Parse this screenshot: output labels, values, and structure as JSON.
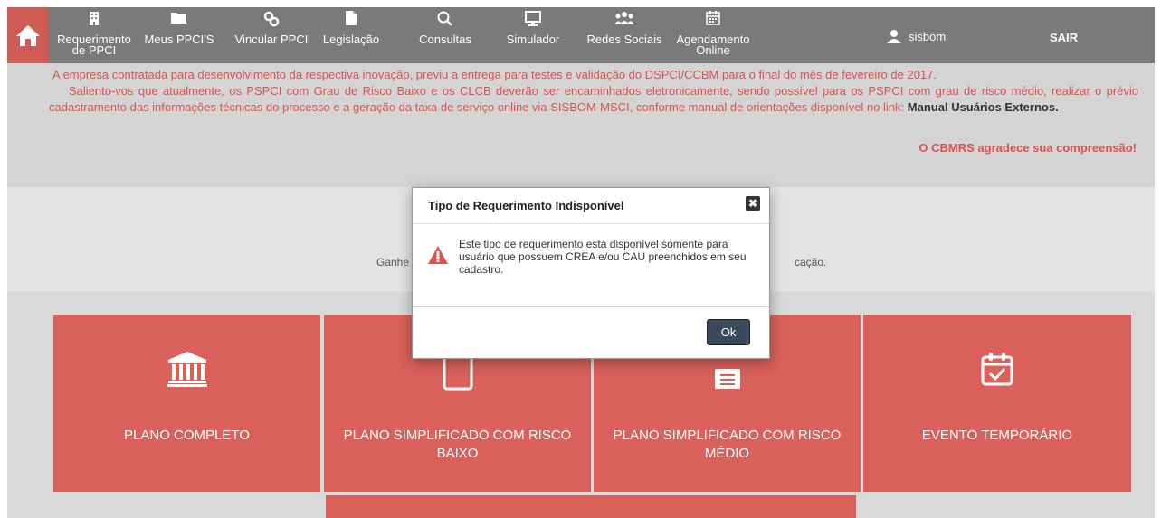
{
  "nav": {
    "home_icon": "home-icon",
    "items": [
      {
        "label": "Requerimento",
        "label2": "de PPCI",
        "icon": "building-icon"
      },
      {
        "label": "Meus PPCI'S",
        "icon": "folder-icon"
      },
      {
        "label": "Vincular PPCI",
        "icon": "link-icon"
      },
      {
        "label": "Legislação",
        "icon": "document-icon"
      },
      {
        "label": "Consultas",
        "icon": "search-icon"
      },
      {
        "label": "Simulador",
        "icon": "monitor-icon"
      },
      {
        "label": "Redes Sociais",
        "icon": "users-icon"
      },
      {
        "label": "Agendamento",
        "label2": "Online",
        "icon": "calendar-icon"
      }
    ],
    "user_name": "sisbom",
    "logout_label": "SAIR"
  },
  "notice": {
    "line1": "A empresa contratada para desenvolvimento da respectiva inovação, previu a entrega para testes e validação do DSPCI/CCBM para o final do mês de fevereiro de 2017.",
    "line2": "Saliento-vos que atualmente, os PSPCI com Grau de Risco Baixo e os CLCB deverão ser encaminhados eletronicamente, sendo possível para os PSPCI com grau de risco médio, realizar o prévio cadastramento das informações técnicas do processo e a geração da taxa de serviço online via SISBOM-MSCI, conforme manual de orientações disponível no link:",
    "link": "Manual Usuários Externos.",
    "thanks": "O CBMRS agradece sua compreensão!"
  },
  "middle": {
    "text_left": "Ganhe",
    "text_right": "cação."
  },
  "cards": [
    {
      "label": "PLANO COMPLETO",
      "icon": "institution-icon"
    },
    {
      "label": "PLANO SIMPLIFICADO COM RISCO BAIXO",
      "icon": "clipboard-icon"
    },
    {
      "label": "PLANO SIMPLIFICADO COM RISCO MÉDIO",
      "icon": "list-doc-icon"
    },
    {
      "label": "EVENTO TEMPORÁRIO",
      "icon": "calendar-check-icon"
    }
  ],
  "modal": {
    "title": "Tipo de Requerimento Indisponível",
    "message": "Este tipo de requerimento está disponível somente para usuário que possuem CREA e/ou CAU preenchidos em seu cadastro.",
    "ok_label": "Ok",
    "close_symbol": "✖"
  },
  "colors": {
    "nav_bg": "#7a7a7a",
    "accent_red": "#d9605b",
    "notice_text": "#d9534f",
    "ok_button": "#3b4a5a"
  }
}
